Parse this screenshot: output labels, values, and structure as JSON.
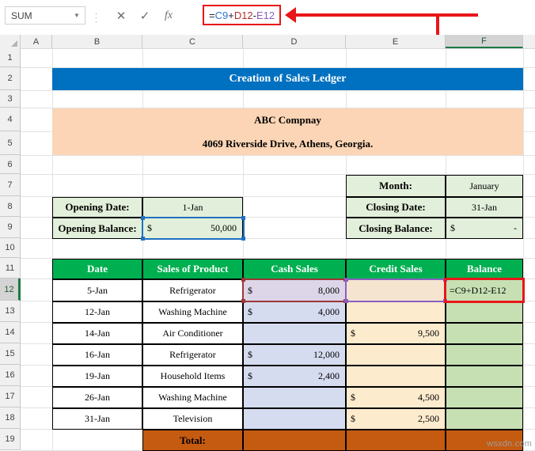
{
  "formula_bar": {
    "name_box_value": "SUM",
    "name_box_caret": "▼",
    "cancel_icon": "✕",
    "enter_icon": "✓",
    "fx_icon": "fx",
    "formula_tokens": [
      {
        "text": "=",
        "color_class": "tok-plain",
        "hex": "#222222"
      },
      {
        "text": "C9",
        "color_class": "tok-blue",
        "hex": "#2e75d4"
      },
      {
        "text": "+",
        "color_class": "tok-plain",
        "hex": "#222222"
      },
      {
        "text": "D12",
        "color_class": "tok-red",
        "hex": "#b03030"
      },
      {
        "text": "-",
        "color_class": "tok-plain",
        "hex": "#222222"
      },
      {
        "text": "E12",
        "color_class": "tok-purp",
        "hex": "#8a5fc0"
      }
    ],
    "formula_text": "=C9+D12-E12"
  },
  "grid": {
    "columns": [
      "A",
      "B",
      "C",
      "D",
      "E",
      "F"
    ],
    "active_column": "F",
    "rows": [
      "1",
      "2",
      "3",
      "4",
      "5",
      "6",
      "7",
      "8",
      "9",
      "10",
      "11",
      "12",
      "13",
      "14",
      "15",
      "16",
      "17",
      "18",
      "19"
    ],
    "active_row": "12"
  },
  "sheet": {
    "title_banner": "Creation of Sales Ledger",
    "company_name": "ABC Compnay",
    "company_address": "4069 Riverside Drive, Athens, Georgia.",
    "opening": {
      "date_label": "Opening Date:",
      "date_value": "1-Jan",
      "balance_label": "Opening Balance:",
      "balance_currency": "$",
      "balance_value": "50,000"
    },
    "closing": {
      "month_label": "Month:",
      "month_value": "January",
      "date_label": "Closing Date:",
      "date_value": "31-Jan",
      "balance_label": "Closing Balance:",
      "balance_currency": "$",
      "balance_value": "-"
    },
    "table": {
      "headers": [
        "Date",
        "Sales of Product",
        "Cash Sales",
        "Credit Sales",
        "Balance"
      ],
      "rows": [
        {
          "date": "5-Jan",
          "product": "Refrigerator",
          "cash_cur": "$",
          "cash": "8,000",
          "credit_cur": "",
          "credit": "",
          "balance": "=C9+D12-E12"
        },
        {
          "date": "12-Jan",
          "product": "Washing Machine",
          "cash_cur": "$",
          "cash": "4,000",
          "credit_cur": "",
          "credit": "",
          "balance": ""
        },
        {
          "date": "14-Jan",
          "product": "Air Conditioner",
          "cash_cur": "",
          "cash": "",
          "credit_cur": "$",
          "credit": "9,500",
          "balance": ""
        },
        {
          "date": "16-Jan",
          "product": "Refrigerator",
          "cash_cur": "$",
          "cash": "12,000",
          "credit_cur": "",
          "credit": "",
          "balance": ""
        },
        {
          "date": "19-Jan",
          "product": "Household Items",
          "cash_cur": "$",
          "cash": "2,400",
          "credit_cur": "",
          "credit": "",
          "balance": ""
        },
        {
          "date": "26-Jan",
          "product": "Washing Machine",
          "cash_cur": "",
          "cash": "",
          "credit_cur": "$",
          "credit": "4,500",
          "balance": ""
        },
        {
          "date": "31-Jan",
          "product": "Television",
          "cash_cur": "",
          "cash": "",
          "credit_cur": "$",
          "credit": "2,500",
          "balance": ""
        }
      ],
      "total_label": "Total:",
      "total_cash": "",
      "total_credit": "",
      "total_balance": ""
    }
  },
  "colors": {
    "banner_blue": "#0070C0",
    "company_peach": "#FBD5B5",
    "header_green": "#00B050",
    "light_green": "#E2EFDA",
    "balance_green": "#C6E0B4",
    "cash_blue": "#D6DCEF",
    "credit_cream": "#FDEBCD",
    "total_orange": "#C55A11",
    "annotation_red": "#E8161A",
    "ref_red": "#9E3636",
    "ref_purple": "#8A5FC0",
    "ref_blue": "#2070C0"
  },
  "watermark": "wsxdn.com"
}
